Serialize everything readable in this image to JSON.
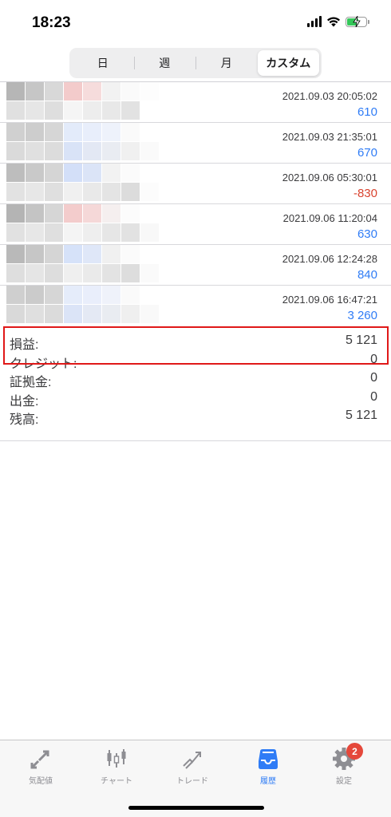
{
  "status_bar": {
    "time": "18:23"
  },
  "period_tabs": [
    {
      "label": "日",
      "active": false
    },
    {
      "label": "週",
      "active": false
    },
    {
      "label": "月",
      "active": false
    },
    {
      "label": "カスタム",
      "active": true
    }
  ],
  "history": [
    {
      "time": "2021.09.03 20:05:02",
      "value": "610",
      "color": "#2f7cf6"
    },
    {
      "time": "2021.09.03 21:35:01",
      "value": "670",
      "color": "#2f7cf6"
    },
    {
      "time": "2021.09.06 05:30:01",
      "value": "-830",
      "color": "#d9432f"
    },
    {
      "time": "2021.09.06 11:20:04",
      "value": "630",
      "color": "#2f7cf6"
    },
    {
      "time": "2021.09.06 12:24:28",
      "value": "840",
      "color": "#2f7cf6"
    },
    {
      "time": "2021.09.06 16:47:21",
      "value": "3 260",
      "color": "#2f7cf6"
    }
  ],
  "summary": [
    {
      "label": "損益:",
      "value": "5 121"
    },
    {
      "label": "クレジット:",
      "value": "0"
    },
    {
      "label": "証拠金:",
      "value": "0"
    },
    {
      "label": "出金:",
      "value": "0"
    },
    {
      "label": "残高:",
      "value": "5 121"
    }
  ],
  "tab_bar": [
    {
      "label": "気配値",
      "icon": "quotes-icon",
      "active": false
    },
    {
      "label": "チャート",
      "icon": "candlestick-icon",
      "active": false
    },
    {
      "label": "トレード",
      "icon": "trade-icon",
      "active": false
    },
    {
      "label": "履歴",
      "icon": "inbox-icon",
      "active": true
    },
    {
      "label": "設定",
      "icon": "gear-icon",
      "active": false,
      "badge": "2"
    }
  ],
  "colors": {
    "accent": "#2f7cf6",
    "loss": "#d9432f",
    "highlight_border": "#e01818",
    "badge": "#e5483b"
  }
}
